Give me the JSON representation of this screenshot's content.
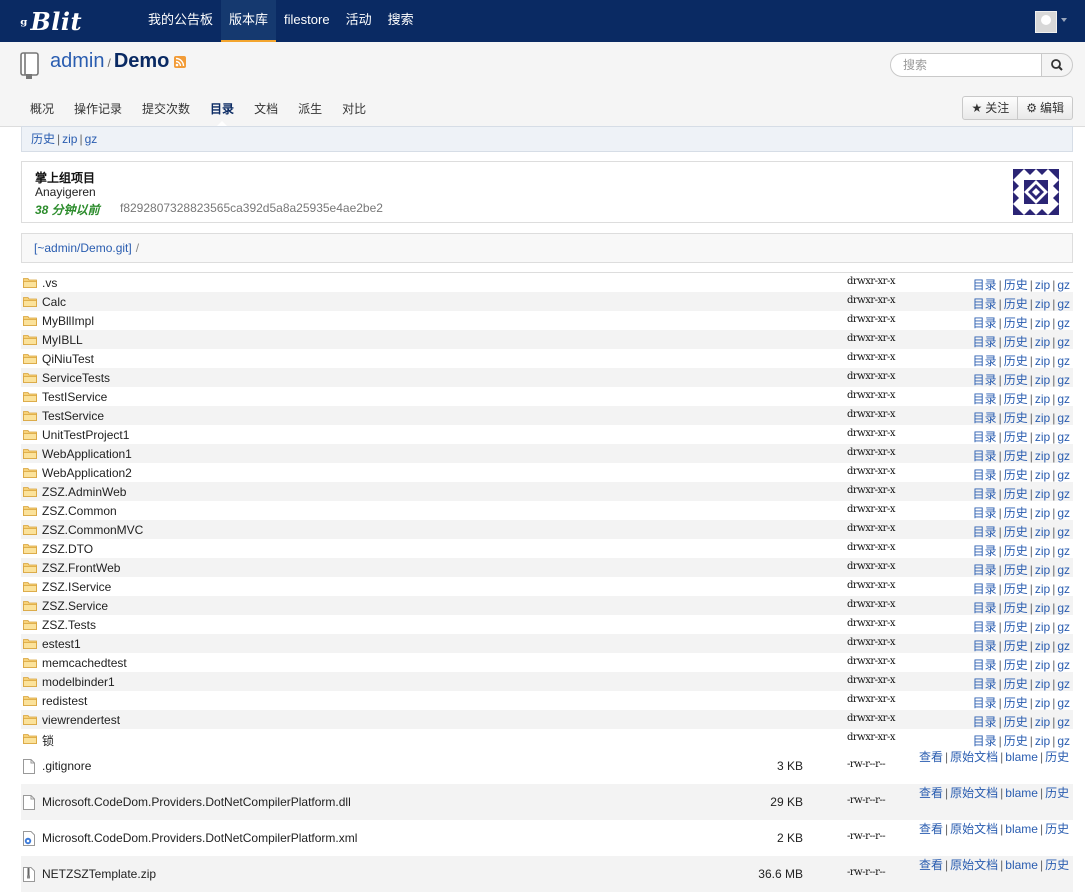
{
  "brand": {
    "logo": "Blit",
    "logo_prefix": "ᵍ"
  },
  "nav": [
    "我的公告板",
    "版本库",
    "filestore",
    "活动",
    "搜索"
  ],
  "repo": {
    "owner": "admin",
    "separator": "/",
    "name": "Demo"
  },
  "search": {
    "placeholder": "搜索"
  },
  "tabs": [
    "概况",
    "操作记录",
    "提交次数",
    "目录",
    "文档",
    "派生",
    "对比"
  ],
  "actions": {
    "watch": "关注",
    "edit": "编辑"
  },
  "crumb": {
    "history": "历史",
    "zip": "zip",
    "gz": "gz"
  },
  "commit": {
    "message": "掌上组项目",
    "author": "Anayigeren",
    "age": "38 分钟以前",
    "hash": "f8292807328823565ca392d5a8a25935e4ae2be2"
  },
  "path": {
    "root": "[~admin/Demo.git]",
    "slash": "/"
  },
  "dir_links": {
    "tree": "目录",
    "history": "历史",
    "zip": "zip",
    "gz": "gz"
  },
  "file_links": {
    "view": "查看",
    "raw": "原始文档",
    "blame": "blame",
    "history": "历史"
  },
  "folders": [
    {
      "name": ".vs",
      "perm": "drwxr-xr-x"
    },
    {
      "name": "Calc",
      "perm": "drwxr-xr-x"
    },
    {
      "name": "MyBllImpl",
      "perm": "drwxr-xr-x"
    },
    {
      "name": "MyIBLL",
      "perm": "drwxr-xr-x"
    },
    {
      "name": "QiNiuTest",
      "perm": "drwxr-xr-x"
    },
    {
      "name": "ServiceTests",
      "perm": "drwxr-xr-x"
    },
    {
      "name": "TestIService",
      "perm": "drwxr-xr-x"
    },
    {
      "name": "TestService",
      "perm": "drwxr-xr-x"
    },
    {
      "name": "UnitTestProject1",
      "perm": "drwxr-xr-x"
    },
    {
      "name": "WebApplication1",
      "perm": "drwxr-xr-x"
    },
    {
      "name": "WebApplication2",
      "perm": "drwxr-xr-x"
    },
    {
      "name": "ZSZ.AdminWeb",
      "perm": "drwxr-xr-x"
    },
    {
      "name": "ZSZ.Common",
      "perm": "drwxr-xr-x"
    },
    {
      "name": "ZSZ.CommonMVC",
      "perm": "drwxr-xr-x"
    },
    {
      "name": "ZSZ.DTO",
      "perm": "drwxr-xr-x"
    },
    {
      "name": "ZSZ.FrontWeb",
      "perm": "drwxr-xr-x"
    },
    {
      "name": "ZSZ.IService",
      "perm": "drwxr-xr-x"
    },
    {
      "name": "ZSZ.Service",
      "perm": "drwxr-xr-x"
    },
    {
      "name": "ZSZ.Tests",
      "perm": "drwxr-xr-x"
    },
    {
      "name": "estest1",
      "perm": "drwxr-xr-x"
    },
    {
      "name": "memcachedtest",
      "perm": "drwxr-xr-x"
    },
    {
      "name": "modelbinder1",
      "perm": "drwxr-xr-x"
    },
    {
      "name": "redistest",
      "perm": "drwxr-xr-x"
    },
    {
      "name": "viewrendertest",
      "perm": "drwxr-xr-x"
    },
    {
      "name": "锁",
      "perm": "drwxr-xr-x"
    }
  ],
  "files": [
    {
      "name": ".gitignore",
      "size": "3 KB",
      "perm": "-rw-r--r--",
      "icon": "file-icon"
    },
    {
      "name": "Microsoft.CodeDom.Providers.DotNetCompilerPlatform.dll",
      "size": "29 KB",
      "perm": "-rw-r--r--",
      "icon": "file-icon"
    },
    {
      "name": "Microsoft.CodeDom.Providers.DotNetCompilerPlatform.xml",
      "size": "2 KB",
      "perm": "-rw-r--r--",
      "icon": "xml-file-icon"
    },
    {
      "name": "NETZSZTemplate.zip",
      "size": "36.6 MB",
      "perm": "-rw-r--r--",
      "icon": "zip-file-icon"
    }
  ]
}
